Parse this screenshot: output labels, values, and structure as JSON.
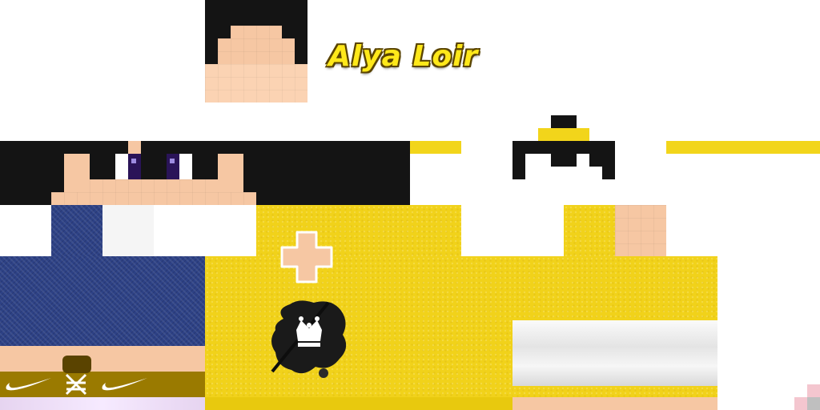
{
  "skin": {
    "title": "Alya Loir"
  },
  "colors": {
    "hair": "#141414",
    "skin": "#f6c7a3",
    "shirt_yellow": "#f2d51b",
    "denim_blue": "#2d4185",
    "shoe_gold": "#9a7a00",
    "eye_purple": "#3b1f7a"
  },
  "icons": [
    "crown-emblem-icon",
    "swoosh-icon",
    "cross-badge-icon"
  ]
}
